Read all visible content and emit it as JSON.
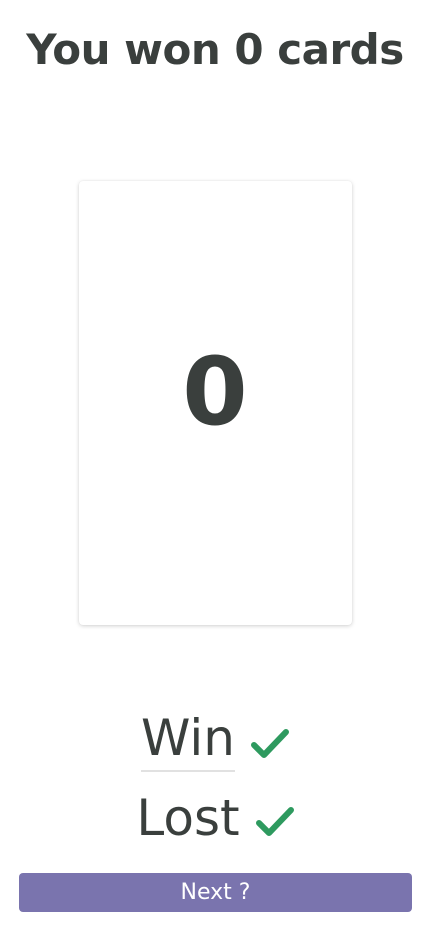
{
  "header": {
    "title": "You won 0 cards"
  },
  "card": {
    "value": "0"
  },
  "results": {
    "win_label": "Win",
    "lost_label": "Lost",
    "win_icon": "checkmark-icon",
    "lost_icon": "checkmark-icon"
  },
  "actions": {
    "next_label": "Next ?"
  },
  "colors": {
    "text": "#3a3f3d",
    "check": "#2e9a5f",
    "button": "#7a74ae",
    "button_text": "#ffffff"
  }
}
